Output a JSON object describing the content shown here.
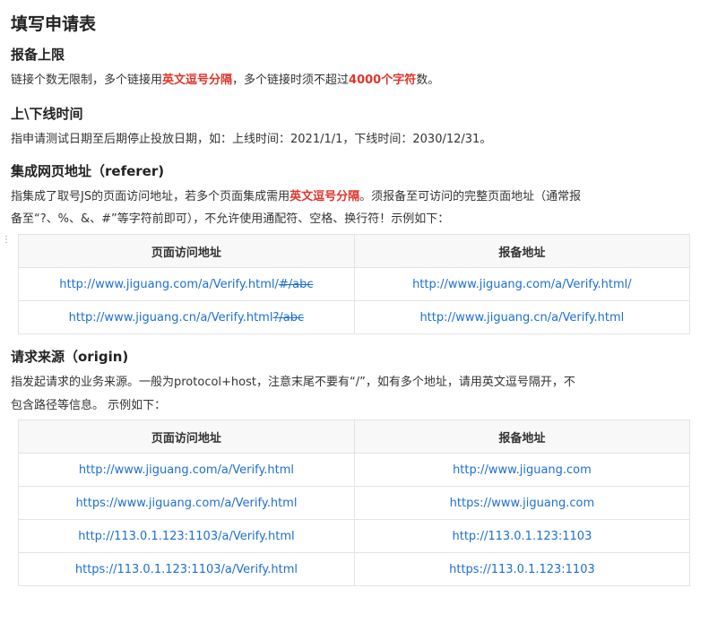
{
  "title": "填写申请表",
  "sections": {
    "limit": {
      "heading": "报备上限",
      "text_a": "链接个数无限制，多个链接用",
      "text_red1": "英文逗号分隔",
      "text_b": "，多个链接时须不超过",
      "text_red2": "4000个字符",
      "text_c": "数。"
    },
    "time": {
      "heading": "上\\下线时间",
      "text": "指申请测试日期至后期停止投放日期，如：上线时间：2021/1/1，下线时间：2030/12/31。"
    },
    "referer": {
      "heading": "集成网页地址（referer)",
      "text_a": "指集成了取号JS的页面访问地址，若多个页面集成需用",
      "text_red": "英文逗号分隔",
      "text_b": "。须报备至可访问的完整页面地址（通常报",
      "text_line2": "备至“?、%、&、#”等字符前即可），不允许使用通配符、空格、换行符！示例如下：",
      "headers": [
        "页面访问地址",
        "报备地址"
      ],
      "rows": [
        {
          "page_main": "http://www.jiguang.com/a/Verify.html/",
          "page_strike": "#/abc",
          "report": "http://www.jiguang.com/a/Verify.html/"
        },
        {
          "page_main": "http://www.jiguang.cn/a/Verify.html",
          "page_strike": "?/abc",
          "report": "http://www.jiguang.cn/a/Verify.html"
        }
      ]
    },
    "origin": {
      "heading": "请求来源（origin)",
      "text_line1": "指发起请求的业务来源。一般为protocol+host，注意末尾不要有“/”，如有多个地址，请用英文逗号隔开，不",
      "text_line2": "包含路径等信息。 示例如下：",
      "headers": [
        "页面访问地址",
        "报备地址"
      ],
      "rows": [
        {
          "page": "http://www.jiguang.com/a/Verify.html",
          "report": "http://www.jiguang.com"
        },
        {
          "page": "https://www.jiguang.com/a/Verify.html",
          "report": "https://www.jiguang.com"
        },
        {
          "page": "http://113.0.1.123:1103/a/Verify.html",
          "report": "http://113.0.1.123:1103"
        },
        {
          "page": "https://113.0.1.123:1103/a/Verify.html",
          "report": "https://113.0.1.123:1103"
        }
      ]
    }
  }
}
